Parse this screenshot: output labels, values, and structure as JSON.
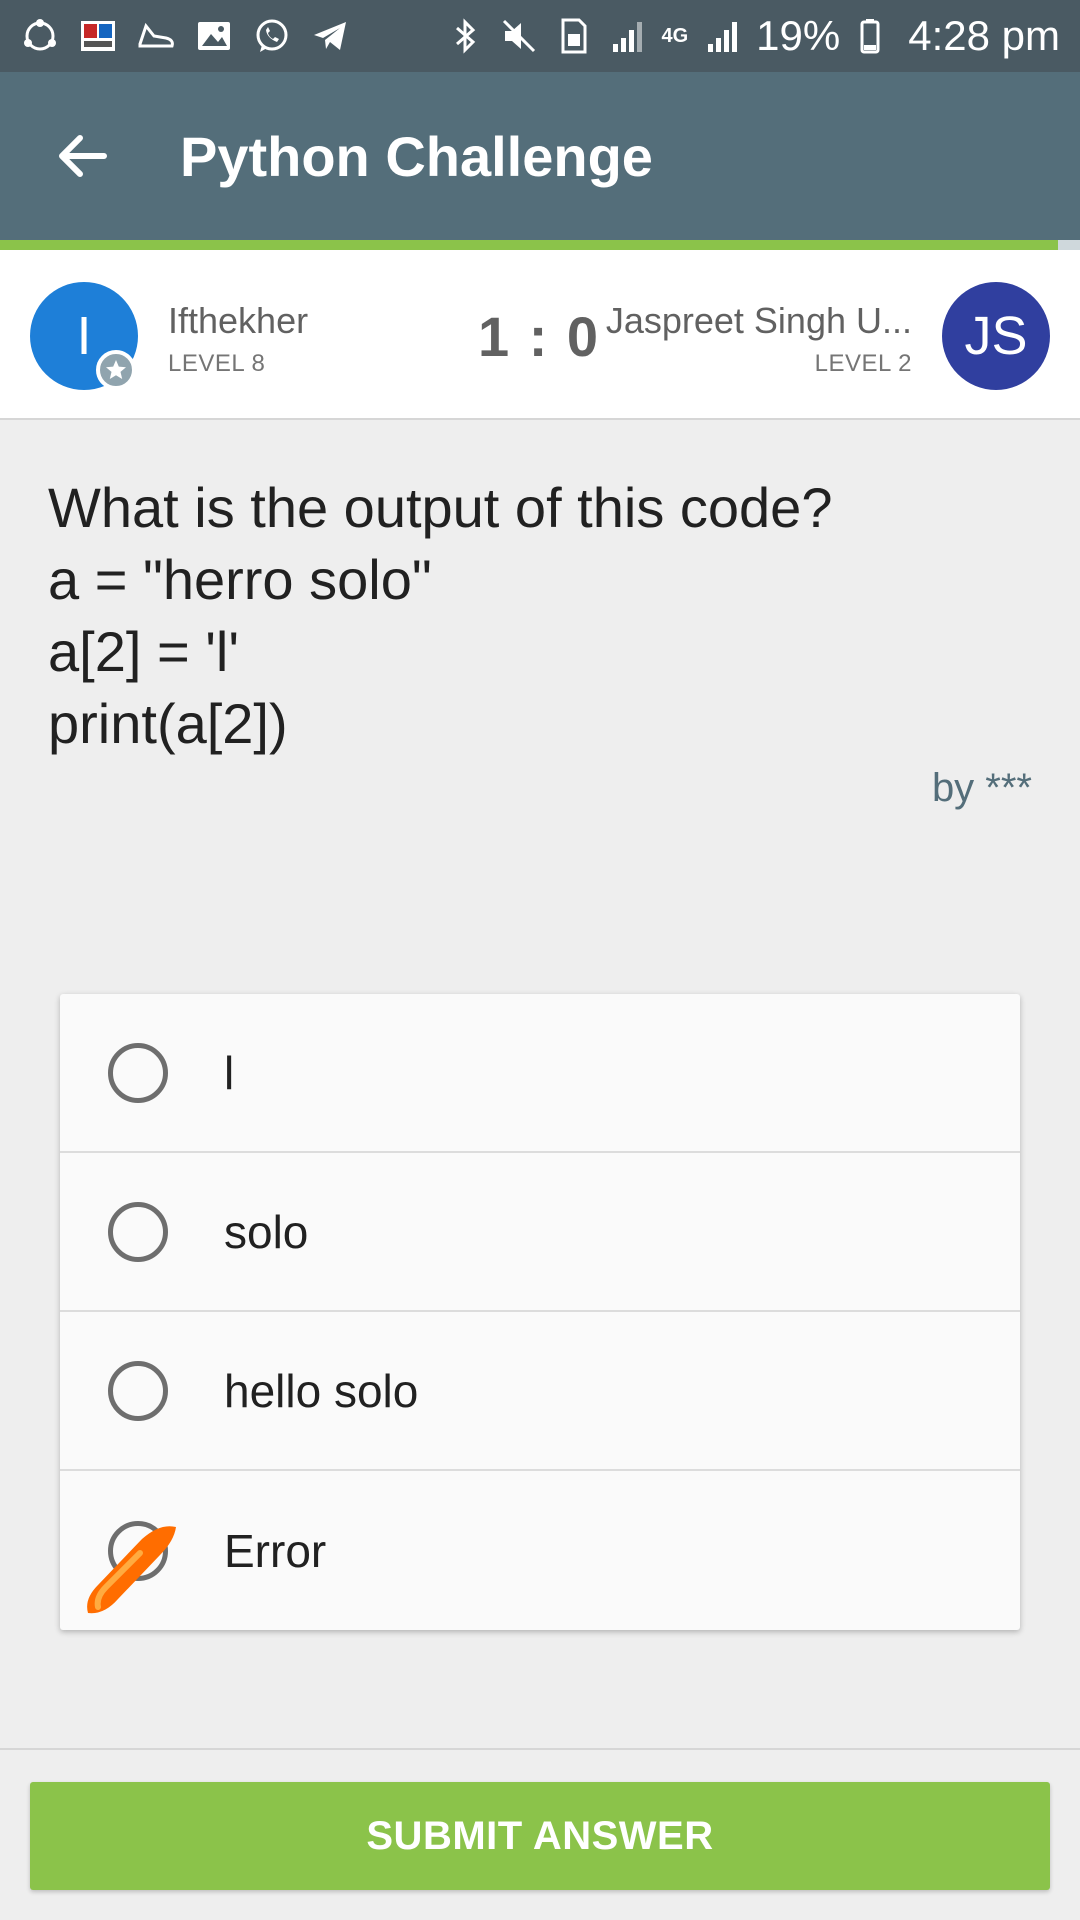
{
  "status_bar": {
    "battery": "19%",
    "time": "4:28 pm",
    "network": "4G",
    "left_icons": [
      "shareit-icon",
      "news-app-icon",
      "shoe-icon",
      "gallery-icon",
      "whatsapp-icon",
      "telegram-icon"
    ],
    "right_icons": [
      "bluetooth-icon",
      "mute-icon",
      "sim-icon",
      "signal-icon",
      "signal-icon",
      "battery-icon"
    ]
  },
  "app_bar": {
    "title": "Python Challenge",
    "back_icon": "arrow-back-icon"
  },
  "colors": {
    "app_bar": "#546e7a",
    "status_bar": "#4a5a63",
    "accent_green": "#8bc34a",
    "player1_avatar": "#1e7fd8",
    "player2_avatar": "#303f9f"
  },
  "match": {
    "player1": {
      "initial": "I",
      "name": "Ifthekher",
      "level": "LEVEL 8"
    },
    "player2": {
      "initial": "JS",
      "name": "Jaspreet Singh U...",
      "level": "LEVEL 2"
    },
    "score": "1 : 0"
  },
  "question": {
    "lines": [
      "What is the output of this code?",
      "a = \"herro solo\"",
      "a[2] = 'l'",
      "print(a[2])"
    ],
    "author": "by ***"
  },
  "answers": [
    {
      "label": "l",
      "selected": false
    },
    {
      "label": "solo",
      "selected": false
    },
    {
      "label": "hello solo",
      "selected": false
    },
    {
      "label": "Error",
      "selected": false
    }
  ],
  "submit_label": "SUBMIT ANSWER"
}
